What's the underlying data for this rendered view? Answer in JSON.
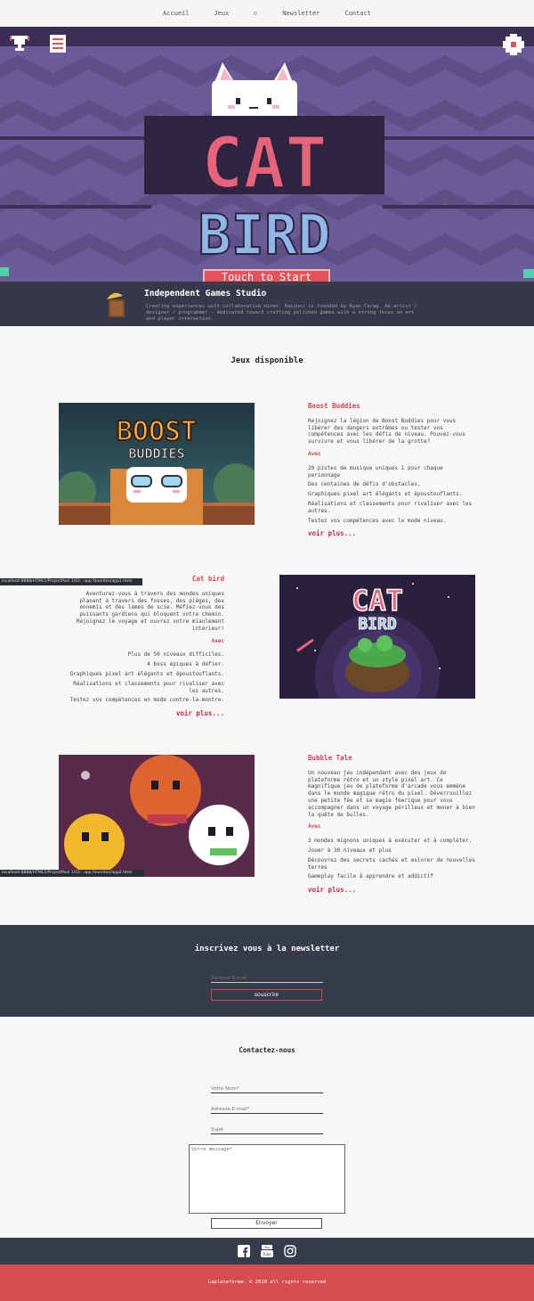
{
  "nav": {
    "items": [
      {
        "label": "Accueil"
      },
      {
        "label": "Jeux"
      },
      {
        "label": "Newsletter"
      },
      {
        "label": "Contact"
      }
    ]
  },
  "hero": {
    "game_logo_line1": "CAT",
    "game_logo_line2": "BIRD",
    "start_label": "Touch to Start",
    "colors": {
      "background": "#6b5b96",
      "accent": "#e4525b"
    },
    "icons": [
      "trophy-icon",
      "menu-list-icon",
      "settings-gear-icon"
    ]
  },
  "studio": {
    "title": "Independent Games Studio",
    "description": "Creating experiences with collaborative minds. Raiyuni is founded by Ryan Carag. An artist / designer / programmer - dedicated toward crafting polished games with a strong focus on art and player interaction."
  },
  "games_section": {
    "title": "Jeux disponible"
  },
  "games": [
    {
      "title": "Boost Buddies",
      "logo_line1": "BOOST",
      "logo_line2": "BUDDIES",
      "description": "Rejoignez la légion de Boost Buddies pour vous libérer des dangers extrêmes ou tester vos compétences avec les défis de niveau. Pouvez-vous survivre et vous libérer de la grotte?",
      "with_label": "Avec",
      "features": [
        "20 pistes de musique uniques 1 pour chaque personnage",
        "Des centaines de défis d'obstacles.",
        "Graphiques pixel art élégants et époustouflants.",
        "Réalisations et classements pour rivaliser avec les autres.",
        "Testez vos compétences avec le mode niveau."
      ],
      "more_label": "voir plus..."
    },
    {
      "title": "Cat bird",
      "logo_line1": "CAT",
      "logo_line2": "BIRD",
      "description": "Aventurez-vous à travers des mondes uniques planant à travers des fosses, des pièges, des ennemis et des lames de scie. Méfiez-vous des puissants gardiens qui bloquent votre chemin. Rejoignez le voyage et ouvrez votre miaulement intérieur!",
      "with_label": "Avec",
      "features": [
        "Plus de 50 niveaux difficiles.",
        "4 boss épiques à défier.",
        "Graphiques pixel art élégants et époustouflants.",
        "Réalisations et classements pour rivaliser avec les autres.",
        "Testez vos compétences en mode contre-la-montre."
      ],
      "more_label": "voir plus..."
    },
    {
      "title": "Bubble Tale",
      "description": "Un nouveau jeu indépendant avec des jeux de plateforme rétro et un style pixel art. Ce magnifique jeu de plateforme d'arcade vous emmène dans le monde magique rétro du pixel. Déverrouillez une petite fée et sa magie féerique pour vous accompagner dans un voyage périlleux et mener à bien la quête de bulles.",
      "with_label": "Avec",
      "features": [
        "3 mondes mignons uniques à exécuter et à compléter.",
        "Jouer à 30 niveaux et plus",
        "Découvrez des secrets cachés et exlorer de nouvelles terres",
        "Gameplay facile à apprendre et addictif"
      ],
      "more_label": "voir plus..."
    }
  ],
  "status_urls": [
    "localhost:8888/HTML5/ProjectPool 1/03 - app favorites/app1.html",
    "localhost:8888/HTML5/ProjectPool 1/03 - app favorites/app2.html"
  ],
  "newsletter": {
    "title": "inscrivez vous à la newsletter",
    "email_placeholder": "Adresse E-mail",
    "submit_label": "souscrire"
  },
  "contact": {
    "title": "Contactez-nous",
    "name_placeholder": "Votre Nom*",
    "email_placeholder": "Adresse E-mail*",
    "subject_placeholder": "Sujet",
    "message_placeholder": "Votre message*",
    "send_label": "Envoyer"
  },
  "footer": {
    "social_icons": [
      "facebook-icon",
      "youtube-icon",
      "instagram-icon"
    ],
    "copyright": "Laplateforme. © 2020 all rights reserved",
    "colors": {
      "dark": "#373c4a",
      "red": "#d64d4f"
    }
  }
}
